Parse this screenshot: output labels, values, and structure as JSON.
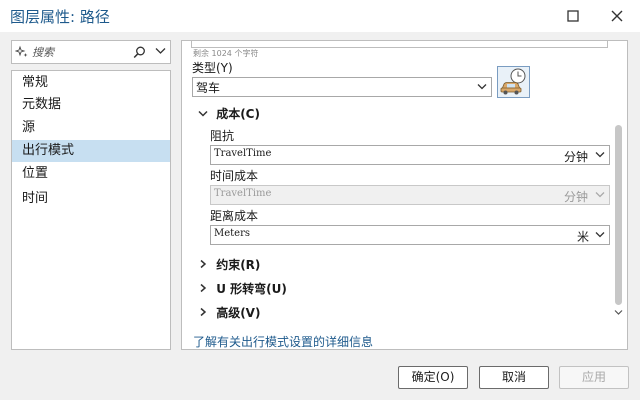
{
  "window": {
    "title": "图层属性: 路径"
  },
  "search": {
    "placeholder": "搜索"
  },
  "nav": {
    "items": [
      {
        "label": "常规"
      },
      {
        "label": "元数据"
      },
      {
        "label": "源"
      },
      {
        "label": "出行模式"
      },
      {
        "label": "位置"
      },
      {
        "label": "时间"
      }
    ],
    "active": "出行模式"
  },
  "panel": {
    "char_count": "剩余 1024 个字符",
    "type_label": "类型(Y)",
    "type_value": "驾车",
    "cost_section": "成本(C)",
    "impedance_label": "阻抗",
    "impedance_value": "TravelTime",
    "impedance_unit": "分钟",
    "time_cost_label": "时间成本",
    "time_cost_value": "TravelTime",
    "time_cost_unit": "分钟",
    "distance_cost_label": "距离成本",
    "distance_cost_value": "Meters",
    "distance_cost_unit": "米",
    "restrictions_section": "约束(R)",
    "uturn_section": "U 形转弯(U)",
    "advanced_section": "高级(V)",
    "help_link": "了解有关出行模式设置的详细信息"
  },
  "buttons": {
    "ok": "确定(O)",
    "cancel": "取消",
    "apply": "应用"
  },
  "colors": {
    "accent": "#1e5a8c",
    "selection": "#c7dff1"
  }
}
